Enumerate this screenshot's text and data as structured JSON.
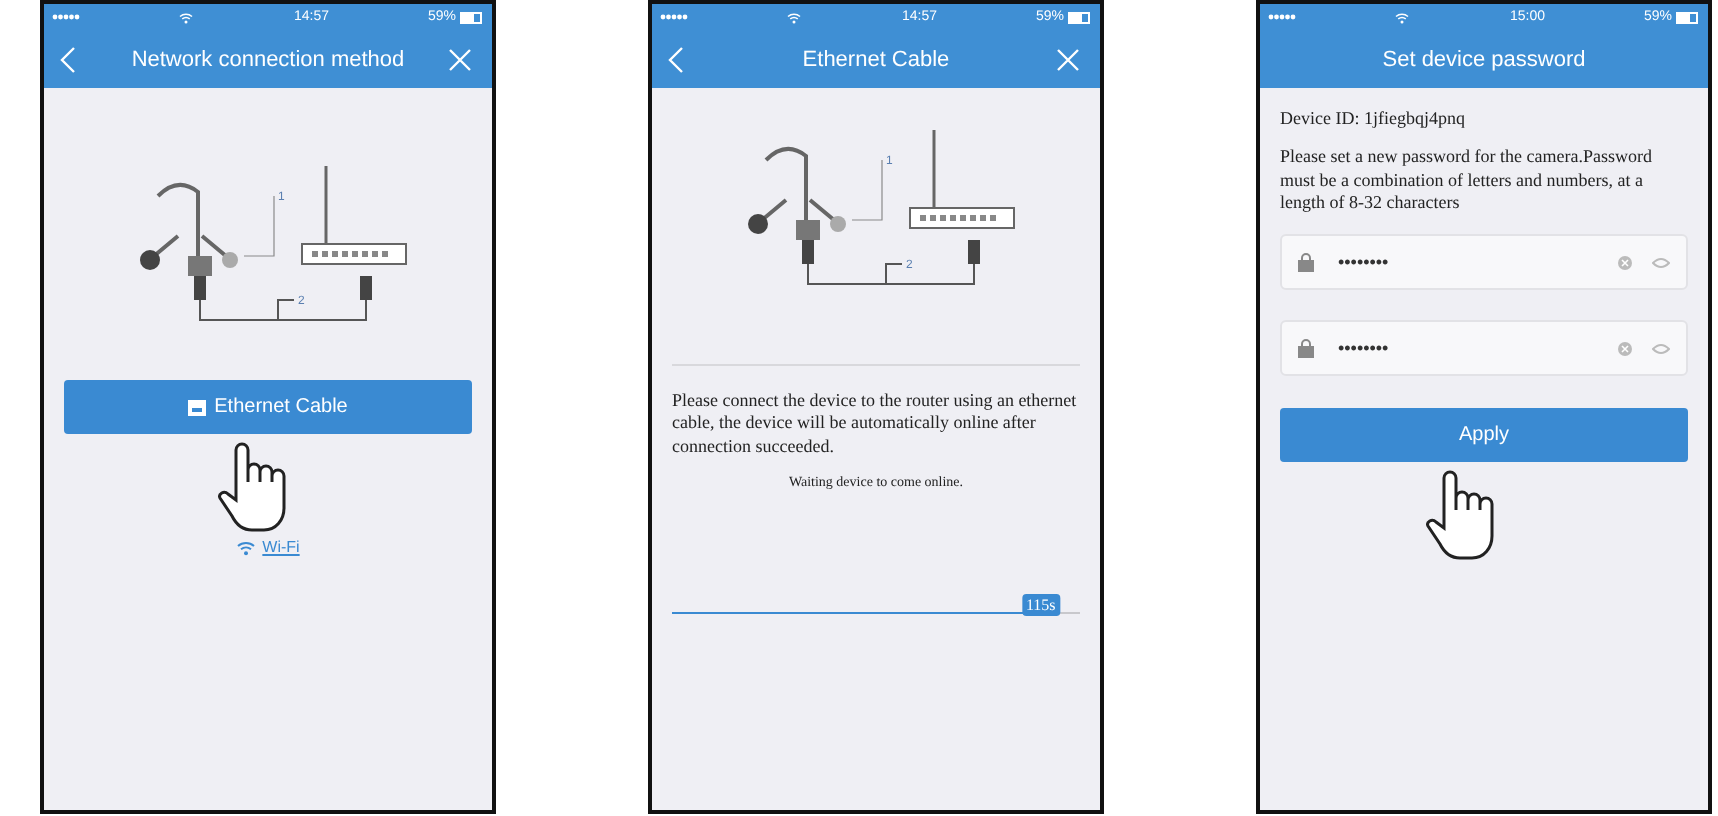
{
  "screens": [
    {
      "kind": "method",
      "status": {
        "time": "14:57",
        "battery": "59%"
      },
      "back": true,
      "close": true,
      "title": "Network connection method",
      "diagram": {
        "callouts": [
          "1",
          "2"
        ]
      },
      "primary_button": {
        "label": "Ethernet Cable"
      },
      "link": {
        "label": "Wi-Fi"
      },
      "tap_hint": true
    },
    {
      "kind": "waiting",
      "status": {
        "time": "14:57",
        "battery": "59%"
      },
      "back": true,
      "close": true,
      "title": "Ethernet Cable",
      "diagram": {
        "callouts": [
          "1",
          "2"
        ]
      },
      "instructions": "Please connect the device to the router using an ethernet cable, the device will be automatically online after connection succeeded.",
      "waiting_text": "Waiting device to come online.",
      "progress": {
        "level": 0.95,
        "badge": "115s"
      },
      "tap_hint": false
    },
    {
      "kind": "password",
      "status": {
        "time": "15:00",
        "battery": "59%"
      },
      "back": false,
      "close": false,
      "title": "Set device password",
      "device_id": "Device ID: 1jfiegbqj4pnq",
      "instructions": "Please set a new password for the camera.Password must be a combination of letters and numbers, at a length of 8-32 characters",
      "fields": [
        {
          "value": "••••••••"
        },
        {
          "value": "••••••••"
        }
      ],
      "primary_button": {
        "label": "Apply"
      },
      "tap_hint": true
    }
  ]
}
